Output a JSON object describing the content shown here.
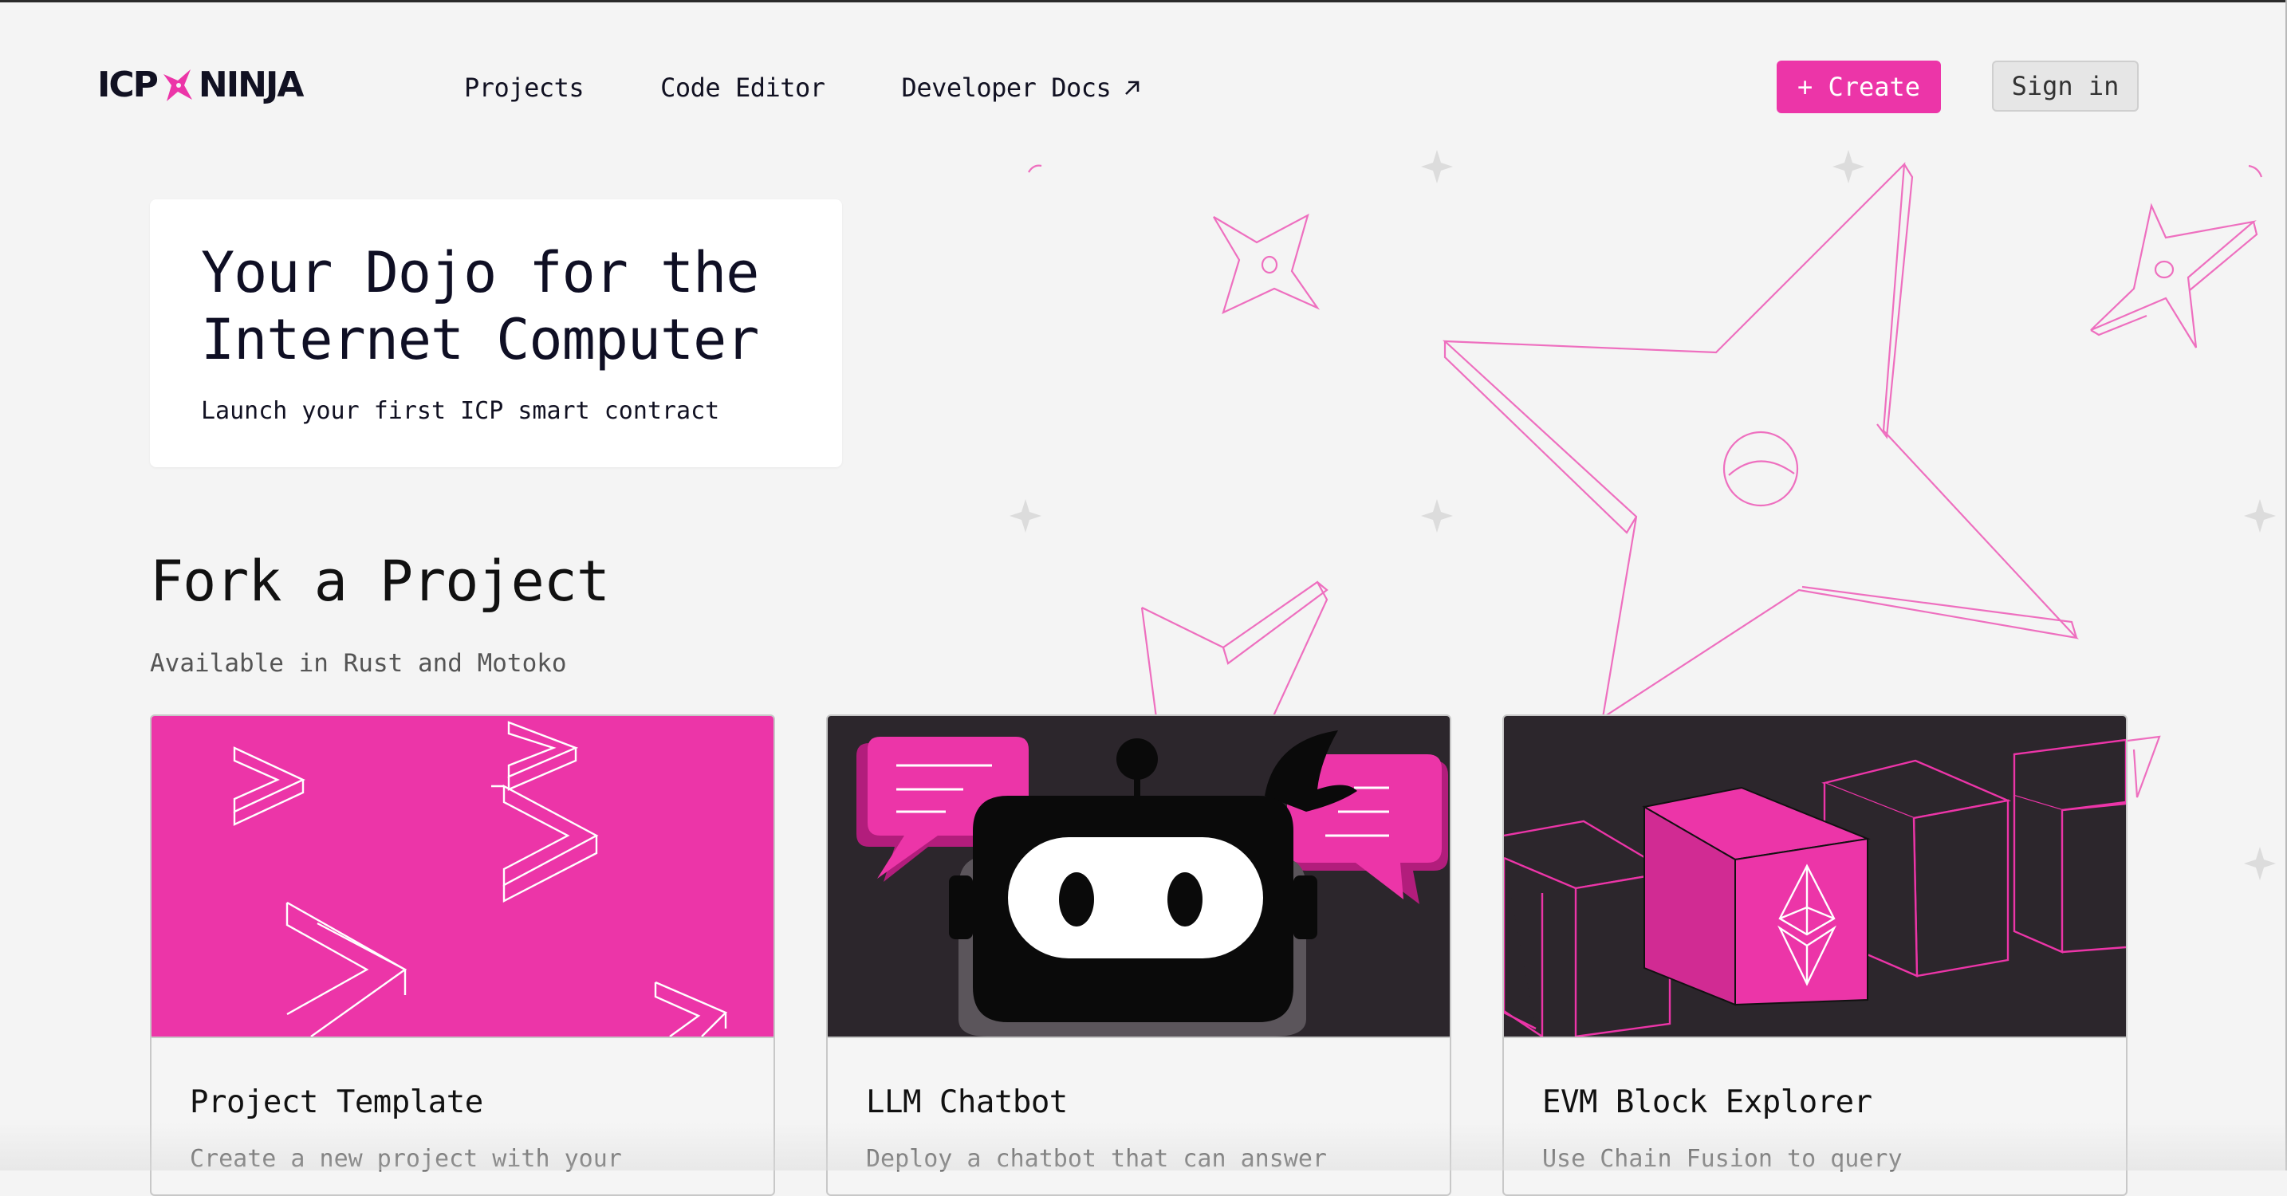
{
  "header": {
    "logo_left": "ICP",
    "logo_right": "NINJA",
    "nav": [
      {
        "label": "Projects"
      },
      {
        "label": "Code Editor"
      },
      {
        "label": "Developer Docs"
      }
    ],
    "create_label": "+ Create",
    "signin_label": "Sign in"
  },
  "hero": {
    "title": "Your Dojo for the Internet Computer",
    "subtitle": "Launch your first ICP smart contract"
  },
  "section": {
    "title": "Fork a Project",
    "subtitle": "Available in Rust and Motoko"
  },
  "projects": [
    {
      "title": "Project Template",
      "description": "Create a new project with your"
    },
    {
      "title": "LLM Chatbot",
      "description": "Deploy a chatbot that can answer"
    },
    {
      "title": "EVM Block Explorer",
      "description": "Use Chain Fusion to query"
    }
  ],
  "colors": {
    "accent": "#ec35a8",
    "dark_card": "#2c262c",
    "background": "#f4f4f4"
  },
  "icons": {
    "logo_mark": "shuriken-icon",
    "external_link": "arrow-up-right-icon"
  }
}
